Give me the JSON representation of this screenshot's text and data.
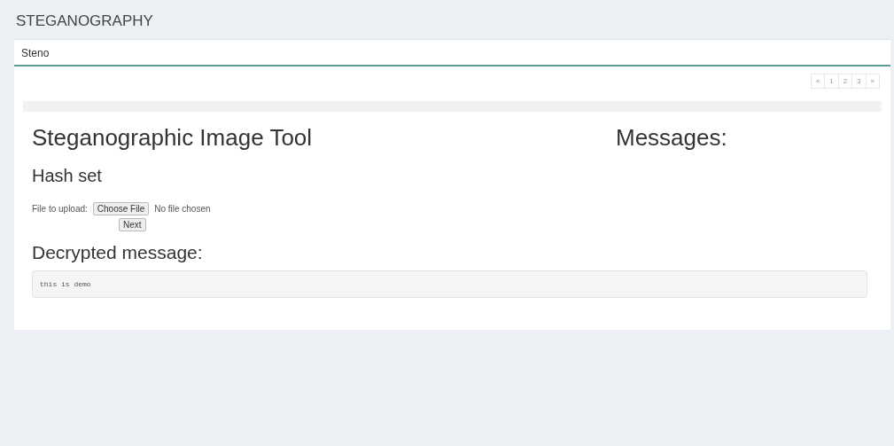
{
  "app_title": "STEGANOGRAPHY",
  "tabs": [
    {
      "label": "Steno",
      "selected": true
    }
  ],
  "pagination": [
    {
      "label": "«",
      "selected": false
    },
    {
      "label": "1",
      "selected": false
    },
    {
      "label": "2",
      "selected": false
    },
    {
      "label": "3",
      "selected": false
    },
    {
      "label": "»",
      "selected": false
    }
  ],
  "tool_title": "Steganographic Image Tool",
  "messages_title": "Messages:",
  "section_title": "Hash set",
  "upload": {
    "label": "File to upload:",
    "button": "Choose File",
    "status": "No file chosen"
  },
  "next_button": "Next",
  "decrypted_title": "Decrypted message:",
  "decrypted_text": "this is demo"
}
